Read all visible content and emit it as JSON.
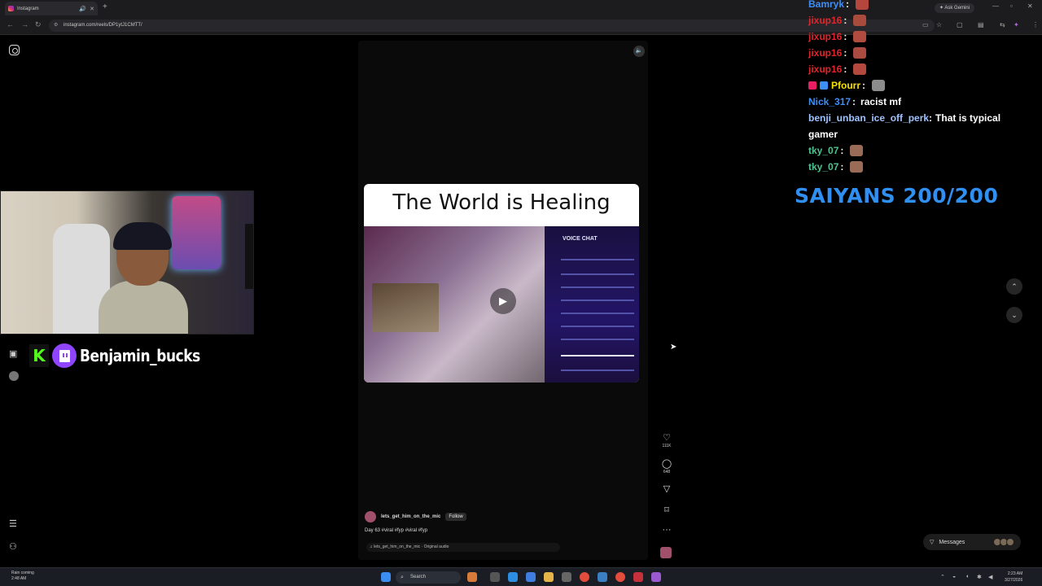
{
  "browser": {
    "tab_title": "Instagram",
    "address": "instagram.com/reels/DP1ytJ1CMTT/",
    "ask_gemini": "Ask Gemini"
  },
  "reel": {
    "title": "The World is Healing",
    "panel_label": "VOICE CHAT",
    "likes": "111K",
    "comments": "648",
    "author": "lets_get_him_on_the_mic",
    "follow_label": "Follow",
    "caption": "Day 63 #viral #fyp #viral #fyp",
    "audio": "♫ lets_get_him_on_the_mic · Original audio"
  },
  "messages_label": "Messages",
  "streamer": {
    "name": "Benjamin_bucks",
    "kick_letter": "K"
  },
  "chat": [
    {
      "user": "Bamryk",
      "text": "",
      "color": "#3d8ef5",
      "emote": true
    },
    {
      "user": "jixup16",
      "text": "",
      "color": "#e0252a",
      "emote": true
    },
    {
      "user": "jixup16",
      "text": "",
      "color": "#e0252a",
      "emote": true
    },
    {
      "user": "jixup16",
      "text": "",
      "color": "#e0252a",
      "emote": true
    },
    {
      "user": "jixup16",
      "text": "",
      "color": "#e0252a",
      "emote": true
    },
    {
      "user": "Pfourr",
      "text": "",
      "color": "#f5e000",
      "emote": true
    },
    {
      "user": "Nick_317",
      "text": "racist mf",
      "color": "#3d8ef5",
      "emote": false
    },
    {
      "user": "benji_unban_ice_off_perk",
      "text": "That is typical gamer",
      "color": "#9fc3ff",
      "emote": false
    },
    {
      "user": "tky_07",
      "text": "",
      "color": "#4fc28f",
      "emote": true
    },
    {
      "user": "tky_07",
      "text": "",
      "color": "#4fc28f",
      "emote": true
    }
  ],
  "goal": "SAIYANS 200/200",
  "taskbar": {
    "weather_line1": "Rain coming",
    "weather_line2": "2:48 AM",
    "search_label": "Search",
    "time": "2:23 AM",
    "date": "3/27/2026"
  },
  "colors": {
    "kick": "#53fc18",
    "twitch": "#8f44fd",
    "goal": "#2f90f2"
  }
}
